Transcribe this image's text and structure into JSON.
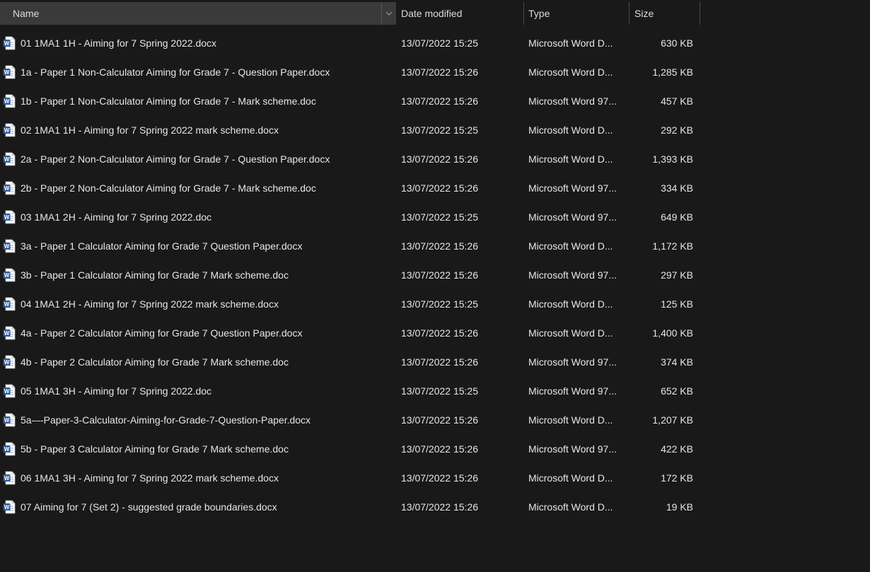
{
  "columns": {
    "name": "Name",
    "date": "Date modified",
    "type": "Type",
    "size": "Size"
  },
  "files": [
    {
      "name": "01 1MA1 1H - Aiming for 7 Spring 2022.docx",
      "date": "13/07/2022 15:25",
      "type": "Microsoft Word D...",
      "size": "630 KB"
    },
    {
      "name": "1a - Paper 1 Non-Calculator Aiming for Grade 7 - Question Paper.docx",
      "date": "13/07/2022 15:26",
      "type": "Microsoft Word D...",
      "size": "1,285 KB"
    },
    {
      "name": "1b - Paper 1 Non-Calculator Aiming for Grade 7 - Mark scheme.doc",
      "date": "13/07/2022 15:26",
      "type": "Microsoft Word 97...",
      "size": "457 KB"
    },
    {
      "name": "02 1MA1 1H - Aiming for 7 Spring 2022 mark scheme.docx",
      "date": "13/07/2022 15:25",
      "type": "Microsoft Word D...",
      "size": "292 KB"
    },
    {
      "name": "2a - Paper 2 Non-Calculator Aiming for Grade 7 - Question Paper.docx",
      "date": "13/07/2022 15:26",
      "type": "Microsoft Word D...",
      "size": "1,393 KB"
    },
    {
      "name": "2b - Paper 2 Non-Calculator Aiming for Grade 7 - Mark scheme.doc",
      "date": "13/07/2022 15:26",
      "type": "Microsoft Word 97...",
      "size": "334 KB"
    },
    {
      "name": "03 1MA1 2H - Aiming for 7 Spring 2022.doc",
      "date": "13/07/2022 15:25",
      "type": "Microsoft Word 97...",
      "size": "649 KB"
    },
    {
      "name": "3a - Paper 1 Calculator Aiming for Grade 7 Question Paper.docx",
      "date": "13/07/2022 15:26",
      "type": "Microsoft Word D...",
      "size": "1,172 KB"
    },
    {
      "name": "3b - Paper 1 Calculator Aiming for Grade 7 Mark scheme.doc",
      "date": "13/07/2022 15:26",
      "type": "Microsoft Word 97...",
      "size": "297 KB"
    },
    {
      "name": "04 1MA1 2H - Aiming for 7 Spring 2022 mark scheme.docx",
      "date": "13/07/2022 15:25",
      "type": "Microsoft Word D...",
      "size": "125 KB"
    },
    {
      "name": "4a - Paper 2 Calculator Aiming for Grade 7 Question Paper.docx",
      "date": "13/07/2022 15:26",
      "type": "Microsoft Word D...",
      "size": "1,400 KB"
    },
    {
      "name": "4b - Paper 2 Calculator Aiming for Grade 7 Mark scheme.doc",
      "date": "13/07/2022 15:26",
      "type": "Microsoft Word 97...",
      "size": "374 KB"
    },
    {
      "name": "05 1MA1 3H - Aiming for 7 Spring 2022.doc",
      "date": "13/07/2022 15:25",
      "type": "Microsoft Word 97...",
      "size": "652 KB"
    },
    {
      "name": "5a-–-Paper-3-Calculator-Aiming-for-Grade-7-Question-Paper.docx",
      "date": "13/07/2022 15:26",
      "type": "Microsoft Word D...",
      "size": "1,207 KB"
    },
    {
      "name": "5b - Paper 3 Calculator Aiming for Grade 7 Mark scheme.doc",
      "date": "13/07/2022 15:26",
      "type": "Microsoft Word 97...",
      "size": "422 KB"
    },
    {
      "name": "06 1MA1 3H - Aiming for 7 Spring 2022 mark scheme.docx",
      "date": "13/07/2022 15:26",
      "type": "Microsoft Word D...",
      "size": "172 KB"
    },
    {
      "name": "07 Aiming for 7 (Set 2) - suggested grade boundaries.docx",
      "date": "13/07/2022 15:26",
      "type": "Microsoft Word D...",
      "size": "19 KB"
    }
  ],
  "colors": {
    "background": "#191919",
    "header_selected": "#3a3a3a",
    "word_blue": "#2b5797"
  },
  "icons": {
    "file": "word-document-icon",
    "sort": "sort-up-icon",
    "dropdown": "chevron-down-icon"
  }
}
